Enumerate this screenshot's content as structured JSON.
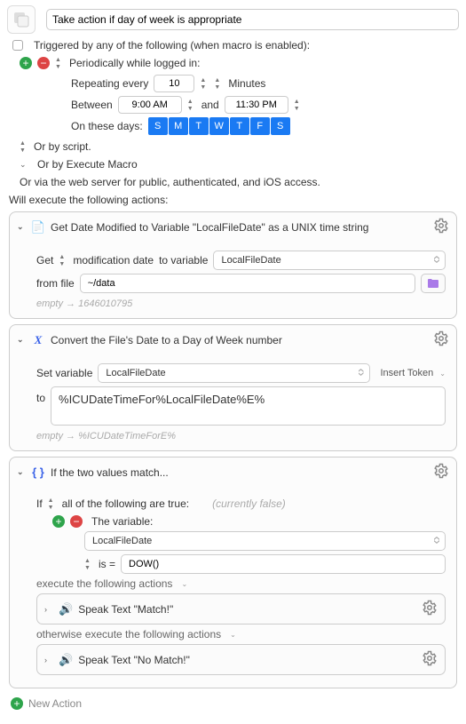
{
  "title": "Take action if day of week is appropriate",
  "enabled_label": "Triggered by any of the following (when macro is enabled):",
  "trigger": {
    "mode_label": "Periodically while logged in:",
    "repeating_label": "Repeating every",
    "repeat_value": "10",
    "repeat_unit": "Minutes",
    "between_label": "Between",
    "between_start": "9:00 AM",
    "and_label": "and",
    "between_end": "11:30 PM",
    "days_label": "On these days:",
    "days": [
      "S",
      "M",
      "T",
      "W",
      "T",
      "F",
      "S"
    ]
  },
  "or_by_script": "Or by script.",
  "or_by_execute": "Or by Execute Macro",
  "or_via_web": "Or via the web server for public, authenticated, and iOS access.",
  "will_execute": "Will execute the following actions:",
  "action1": {
    "title": "Get Date Modified to Variable \"LocalFileDate\" as a UNIX time string",
    "get_label": "Get",
    "get_selector": "modification date",
    "to_variable_label": "to variable",
    "variable_name": "LocalFileDate",
    "from_file_label": "from file",
    "file_path": "~/data",
    "hint_prefix": "empty",
    "hint_value": "1646010795"
  },
  "action2": {
    "title": "Convert the File's Date to a Day of Week number",
    "set_var_label": "Set variable",
    "variable_name": "LocalFileDate",
    "insert_token": "Insert Token",
    "to_label": "to",
    "expression": "%ICUDateTimeFor%LocalFileDate%E%",
    "hint_prefix": "empty",
    "hint_value": "%ICUDateTimeForE%"
  },
  "action3": {
    "title": "If the two values match...",
    "if_label": "If",
    "all_selector": "all of the following are true:",
    "currently_false": "(currently false)",
    "the_variable": "The variable:",
    "variable_name": "LocalFileDate",
    "is_selector": "is =",
    "compare_value": "DOW()",
    "exec_then": "execute the following actions",
    "speak_match": "Speak Text \"Match!\"",
    "exec_else": "otherwise execute the following actions",
    "speak_nomatch": "Speak Text \"No Match!\""
  },
  "new_action": "New Action"
}
